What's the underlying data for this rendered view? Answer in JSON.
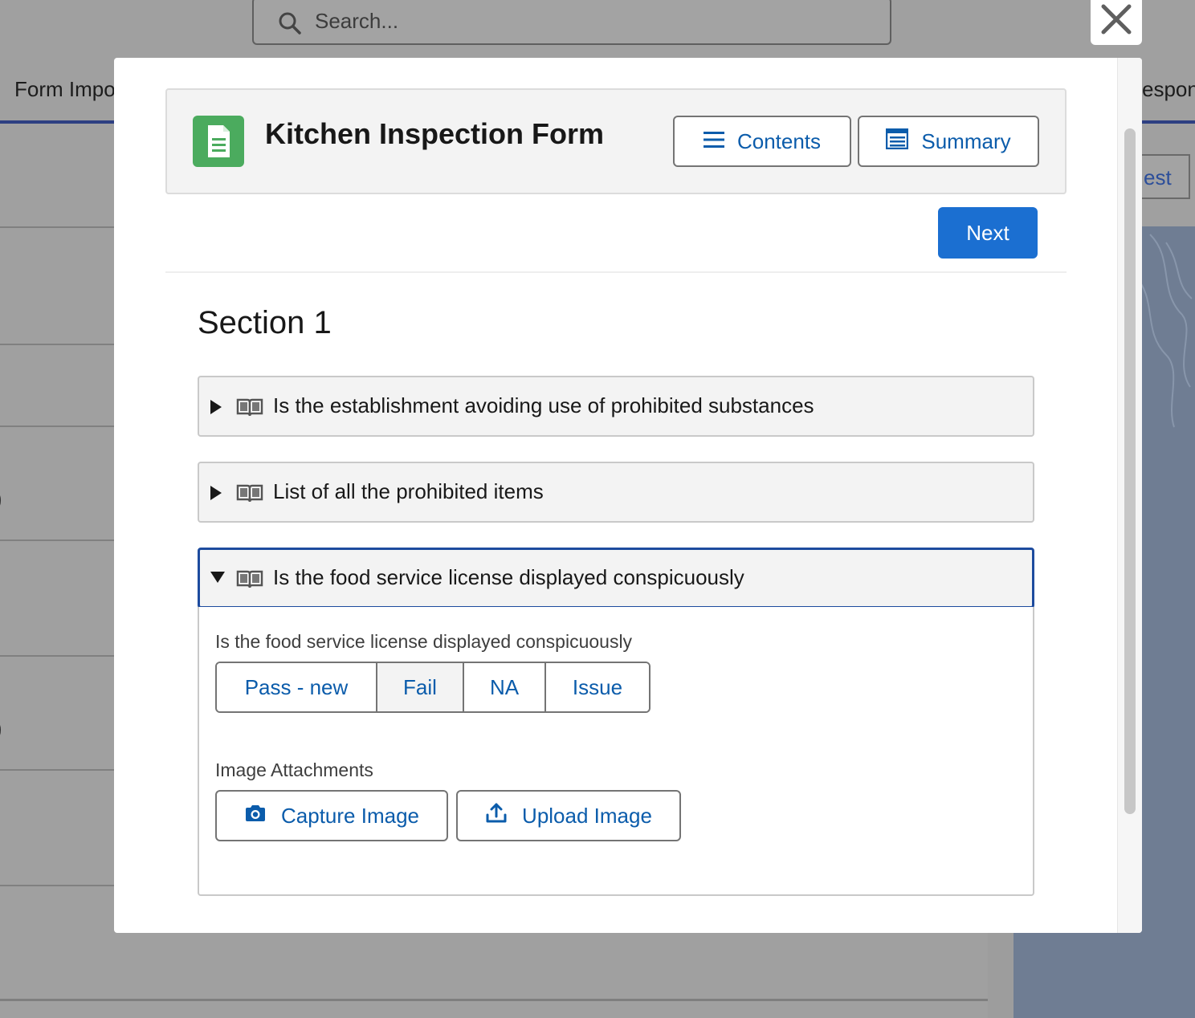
{
  "background": {
    "search_placeholder": "Search...",
    "tab_left": "Form Impo",
    "tab_right": "espon",
    "right_button": "est",
    "paren_1": ")",
    "paren_2": ")"
  },
  "modal": {
    "title": "Kitchen Inspection Form",
    "contents_label": "Contents",
    "summary_label": "Summary",
    "next_label": "Next",
    "section_title": "Section 1",
    "accordions": [
      {
        "label": "Is the establishment avoiding use of prohibited substances",
        "expanded": false
      },
      {
        "label": "List of all the prohibited items",
        "expanded": false
      },
      {
        "label": "Is the food service license displayed conspicuously",
        "expanded": true
      }
    ],
    "question": {
      "label": "Is the food service license displayed conspicuously",
      "options": [
        "Pass - new",
        "Fail",
        "NA",
        "Issue"
      ],
      "selected": "Fail"
    },
    "attachments": {
      "label": "Image Attachments",
      "capture_label": "Capture Image",
      "upload_label": "Upload Image"
    }
  },
  "colors": {
    "brand_blue": "#1b6fd1",
    "link_blue": "#0b5cab",
    "form_icon_green": "#4bab5e",
    "focus_border": "#1d4b9e"
  },
  "icons": [
    "search-icon",
    "close-icon",
    "form-document-icon",
    "list-icon",
    "summary-icon",
    "book-icon",
    "camera-icon",
    "upload-icon"
  ]
}
